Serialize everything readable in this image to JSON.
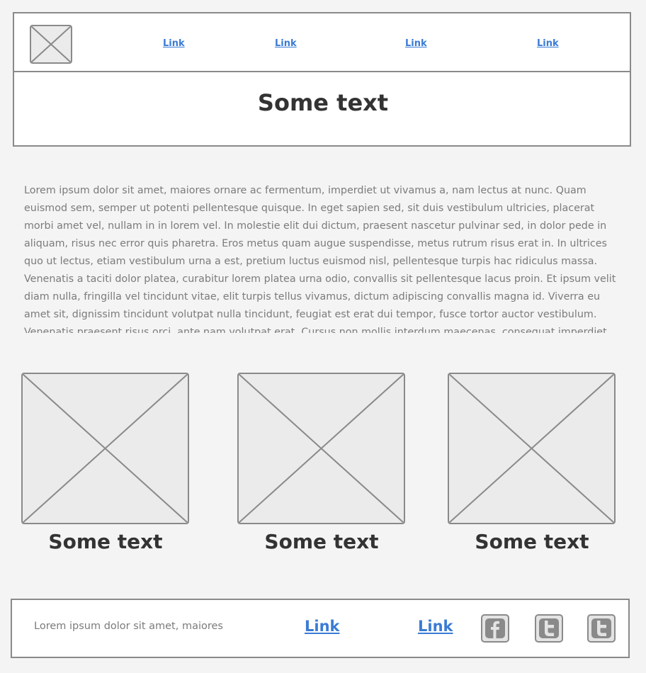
{
  "header": {
    "nav_links": [
      "Link",
      "Link",
      "Link",
      "Link"
    ],
    "title": "Some text"
  },
  "content": {
    "paragraph": "Lorem ipsum dolor sit amet, maiores ornare ac fermentum, imperdiet ut vivamus a, nam lectus at nunc. Quam euismod sem, semper ut potenti pellentesque quisque. In eget sapien sed, sit duis vestibulum ultricies, placerat morbi amet vel, nullam in in lorem vel. In molestie elit dui dictum, praesent nascetur pulvinar sed, in dolor pede in aliquam, risus nec error quis pharetra. Eros metus quam augue suspendisse, metus rutrum risus erat in.  In ultrices quo ut lectus, etiam vestibulum urna a est, pretium luctus euismod nisl, pellentesque turpis hac ridiculus massa. Venenatis a taciti dolor platea, curabitur lorem platea urna odio, convallis sit pellentesque lacus proin. Et ipsum velit diam nulla, fringilla vel tincidunt vitae, elit turpis tellus vivamus, dictum adipiscing convallis magna id. Viverra eu amet sit, dignissim tincidunt volutpat nulla tincidunt, feugiat est erat dui tempor, fusce tortor auctor vestibulum. Venenatis praesent risus orci, ante nam volutpat erat. Cursus non mollis interdum maecenas, consequat imperdiet"
  },
  "cards": [
    {
      "caption": "Some text"
    },
    {
      "caption": "Some text"
    },
    {
      "caption": "Some text"
    }
  ],
  "footer": {
    "text": "Lorem ipsum dolor sit amet, maiores",
    "links": [
      "Link",
      "Link"
    ],
    "social_icons": [
      "facebook-icon",
      "twitter-icon",
      "twitter-icon"
    ]
  },
  "colors": {
    "link": "#3a7bd5",
    "border": "#8a8a8a",
    "placeholder": "#ebebeb",
    "background": "#f4f4f4"
  }
}
